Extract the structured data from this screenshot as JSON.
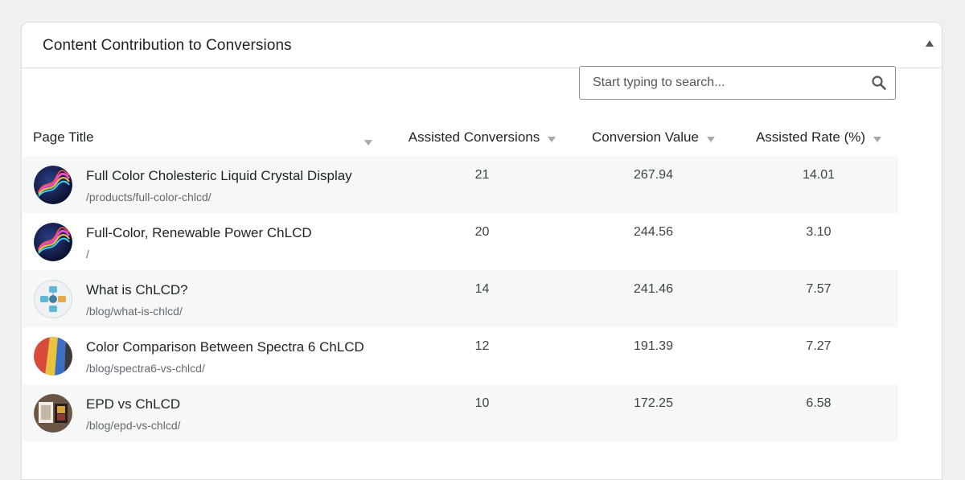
{
  "panel": {
    "title": "Content Contribution to Conversions",
    "collapse_icon": "triangle-up-icon"
  },
  "search": {
    "placeholder": "Start typing to search...",
    "value": "",
    "icon": "magnifier-icon"
  },
  "table": {
    "columns": [
      "Page Title",
      "Assisted Conversions",
      "Conversion Value",
      "Assisted Rate (%)"
    ],
    "rows": [
      {
        "title": "Full Color Cholesteric Liquid Crystal Display",
        "path": "/products/full-color-chlcd/",
        "assisted_conversions": "21",
        "conversion_value": "267.94",
        "assisted_rate": "14.01"
      },
      {
        "title": "Full-Color, Renewable Power ChLCD",
        "path": "/",
        "assisted_conversions": "20",
        "conversion_value": "244.56",
        "assisted_rate": "3.10"
      },
      {
        "title": "What is ChLCD?",
        "path": "/blog/what-is-chlcd/",
        "assisted_conversions": "14",
        "conversion_value": "241.46",
        "assisted_rate": "7.57"
      },
      {
        "title": "Color Comparison Between Spectra 6 ChLCD",
        "path": "/blog/spectra6-vs-chlcd/",
        "assisted_conversions": "12",
        "conversion_value": "191.39",
        "assisted_rate": "7.27"
      },
      {
        "title": "EPD vs ChLCD",
        "path": "/blog/epd-vs-chlcd/",
        "assisted_conversions": "10",
        "conversion_value": "172.25",
        "assisted_rate": "6.58"
      }
    ]
  },
  "colors": {
    "background": "#f0f0f1",
    "panel": "#ffffff",
    "row_alt": "#f6f7f7",
    "text": "#1d2327",
    "muted": "#646970"
  }
}
